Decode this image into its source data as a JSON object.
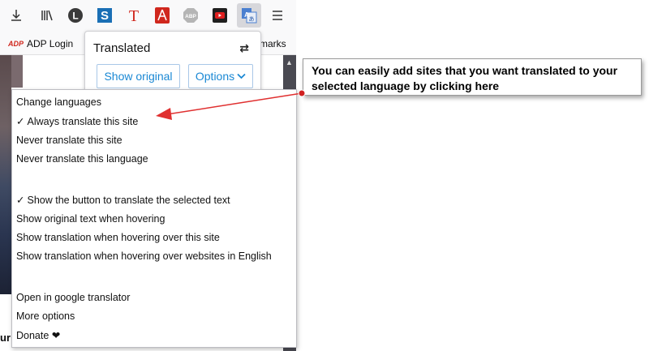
{
  "toolbar": {
    "icons": [
      {
        "name": "download-icon"
      },
      {
        "name": "library-icon"
      },
      {
        "name": "l-extension-icon",
        "glyph": "L"
      },
      {
        "name": "s-extension-icon",
        "glyph": "S"
      },
      {
        "name": "t-extension-icon",
        "glyph": "T"
      },
      {
        "name": "acrobat-icon"
      },
      {
        "name": "adblock-icon",
        "glyph": "ABP"
      },
      {
        "name": "youtube-icon"
      },
      {
        "name": "translate-icon"
      },
      {
        "name": "menu-icon"
      }
    ],
    "colors": {
      "red": "#d0271d",
      "blue": "#1a6fb5",
      "dark": "#333333"
    }
  },
  "bookmarks": {
    "adp_logo": "ADP",
    "adp_label": "ADP Login",
    "overflow_label": "marks"
  },
  "popup": {
    "title": "Translated",
    "show_original_label": "Show original",
    "options_label": "Options",
    "accent_color": "#1a88d4"
  },
  "menu": {
    "items": [
      {
        "label": "Change languages",
        "checked": false
      },
      {
        "label": "Always translate this site",
        "checked": true
      },
      {
        "label": "Never translate this site",
        "checked": false
      },
      {
        "label": "Never translate this language",
        "checked": false
      },
      {
        "label": "Show the button to translate the selected text",
        "checked": true
      },
      {
        "label": "Show original text when hovering",
        "checked": false
      },
      {
        "label": "Show translation when hovering over this site",
        "checked": false
      },
      {
        "label": "Show translation when hovering over websites in English",
        "checked": false
      },
      {
        "label": "Open in google translator",
        "checked": false
      },
      {
        "label": "More options",
        "checked": false
      },
      {
        "label": "Donate",
        "checked": false
      }
    ],
    "check_glyph": "✓",
    "heart_glyph": "❤"
  },
  "page": {
    "partial_text": "ur"
  },
  "callout": {
    "text": "You can easily add sites that you want translated to your selected language by clicking here",
    "arrow_color": "#e03030"
  }
}
